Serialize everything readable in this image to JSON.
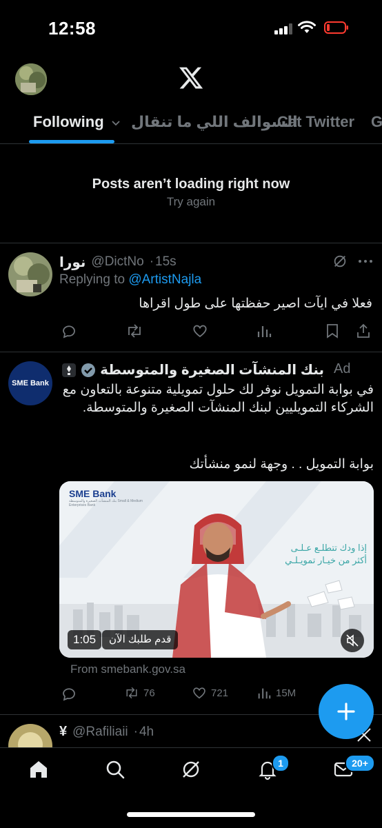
{
  "status_bar": {
    "time": "12:58"
  },
  "header": {
    "tabs": [
      {
        "label": "Following"
      },
      {
        "label": "السوالف اللي ما تنقال"
      },
      {
        "label": "Cat Twitter"
      },
      {
        "label": "G"
      }
    ]
  },
  "empty_state": {
    "title": "Posts aren’t loading right now",
    "retry": "Try again"
  },
  "tweet1": {
    "name": "نورا",
    "handle": "@DictNo",
    "time": "15s",
    "replying_prefix": "Replying to ",
    "replying_to": "@ArtistNajla",
    "text": "فعلا في ايآت اصير حفظتها على طول اقراها"
  },
  "ad": {
    "name": "بنك المنشآت الصغيرة والمتوسطة",
    "ad_label": "Ad",
    "avatar_text": "SME Bank",
    "text": "في بوابة التمويل نوفر لك حلول تمويلية متنوعة بالتعاون مع الشركاء التمويليين لبنك المنشآت الصغيرة والمتوسطة.",
    "text2": "بوابة التمويل . . وجهة لنمو منشأتك",
    "media_logo": "SME Bank",
    "media_logo_sub": "بنك المنشآت الصغيرة والمتوسطة Small & Medium Enterprises Bank",
    "media_headline_1": "إذا ودك تتطلـع عـلـى",
    "media_headline_2": "أكثر من خيـار تمويـلـي",
    "cta": "قدم طلبك الآن",
    "duration": "1:05",
    "from": "From smebank.gov.sa",
    "retweets": "76",
    "likes": "721",
    "views": "15M"
  },
  "tweet3": {
    "name": "¥",
    "handle": "@Rafiliaii",
    "time": "4h"
  },
  "bottom_nav": {
    "notifications_badge": "1",
    "messages_badge": "20+"
  },
  "colors": {
    "accent": "#1d9bf0",
    "background": "#000000",
    "muted": "#71767b"
  }
}
